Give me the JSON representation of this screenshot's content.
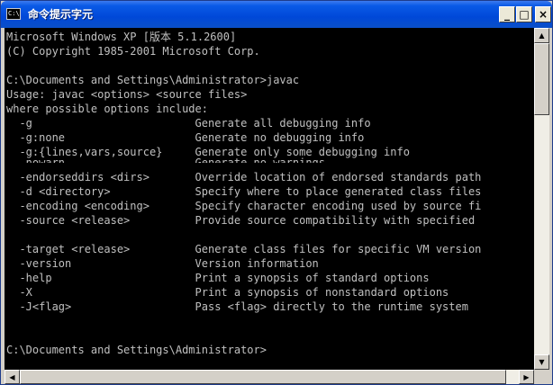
{
  "window": {
    "title": "命令提示字元",
    "icon_text": "C:\\",
    "icon": "cmd-icon",
    "minimize_glyph": "_",
    "maximize_glyph": "□",
    "close_glyph": "×"
  },
  "console": {
    "lines": [
      "Microsoft Windows XP [版本 5.1.2600]",
      "(C) Copyright 1985-2001 Microsoft Corp.",
      "",
      "C:\\Documents and Settings\\Administrator>javac",
      "Usage: javac <options> <source files>",
      "where possible options include:",
      "  -g                         Generate all debugging info",
      "  -g:none                    Generate no debugging info",
      "  -g:{lines,vars,source}     Generate only some debugging info",
      "  -nowarn                    Generate no warnings",
      "  -endorseddirs <dirs>       Override location of endorsed standards path",
      "  -d <directory>             Specify where to place generated class files",
      "  -encoding <encoding>       Specify character encoding used by source fi",
      "  -source <release>          Provide source compatibility with specified",
      "",
      "  -target <release>          Generate class files for specific VM version",
      "  -version                   Version information",
      "  -help                      Print a synopsis of standard options",
      "  -X                         Print a synopsis of nonstandard options",
      "  -J<flag>                   Pass <flag> directly to the runtime system",
      "",
      "",
      "C:\\Documents and Settings\\Administrator>"
    ]
  },
  "scrollbars": {
    "up_glyph": "▲",
    "down_glyph": "▼",
    "left_glyph": "◀",
    "right_glyph": "▶"
  }
}
